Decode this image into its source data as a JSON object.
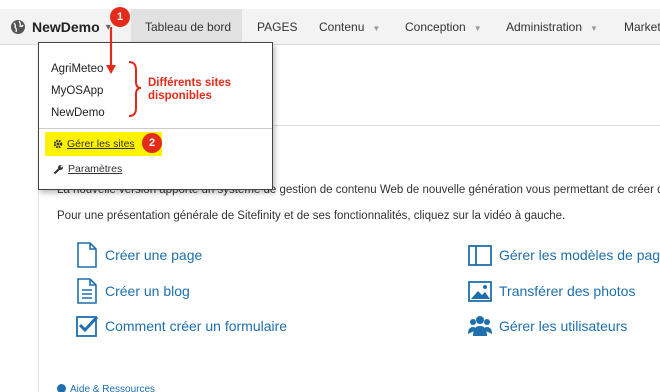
{
  "topbar": {
    "site_name": "NewDemo",
    "nav": [
      {
        "label": "Tableau de bord",
        "active": true,
        "has_menu": false
      },
      {
        "label": "PAGES",
        "active": false,
        "has_menu": false
      },
      {
        "label": "Contenu",
        "active": false,
        "has_menu": true
      },
      {
        "label": "Conception",
        "active": false,
        "has_menu": true
      },
      {
        "label": "Administration",
        "active": false,
        "has_menu": true
      },
      {
        "label": "Market",
        "active": false,
        "has_menu": false
      }
    ]
  },
  "dropdown": {
    "sites": [
      "AgriMeteo",
      "MyOSApp",
      "NewDemo"
    ],
    "manage_label": "Gérer les sites",
    "settings_label": "Paramètres"
  },
  "annotations": {
    "badge1": "1",
    "badge2": "2",
    "sites_note_line1": "Différents sites",
    "sites_note_line2": "disponibles",
    "color": "#e22b1b",
    "highlight_color": "#fff200"
  },
  "main": {
    "intro_line1": "La nouvelle version apporte un système de gestion de contenu Web de nouvelle génération vous permettant de créer d",
    "intro_line2": "Pour une présentation générale de Sitefinity et de ses fonctionnalités, cliquez sur la vidéo à gauche.",
    "actions": [
      {
        "label": "Créer une page",
        "icon": "page-icon"
      },
      {
        "label": "Créer un blog",
        "icon": "blog-icon"
      },
      {
        "label": "Comment créer un formulaire",
        "icon": "form-check-icon"
      },
      {
        "label": "Gérer les modèles de pag",
        "icon": "template-icon"
      },
      {
        "label": "Transférer des photos",
        "icon": "photo-icon"
      },
      {
        "label": "Gérer les utilisateurs",
        "icon": "users-icon"
      }
    ],
    "help_label": "Aide & Ressources",
    "accent_color": "#1f6fad"
  }
}
